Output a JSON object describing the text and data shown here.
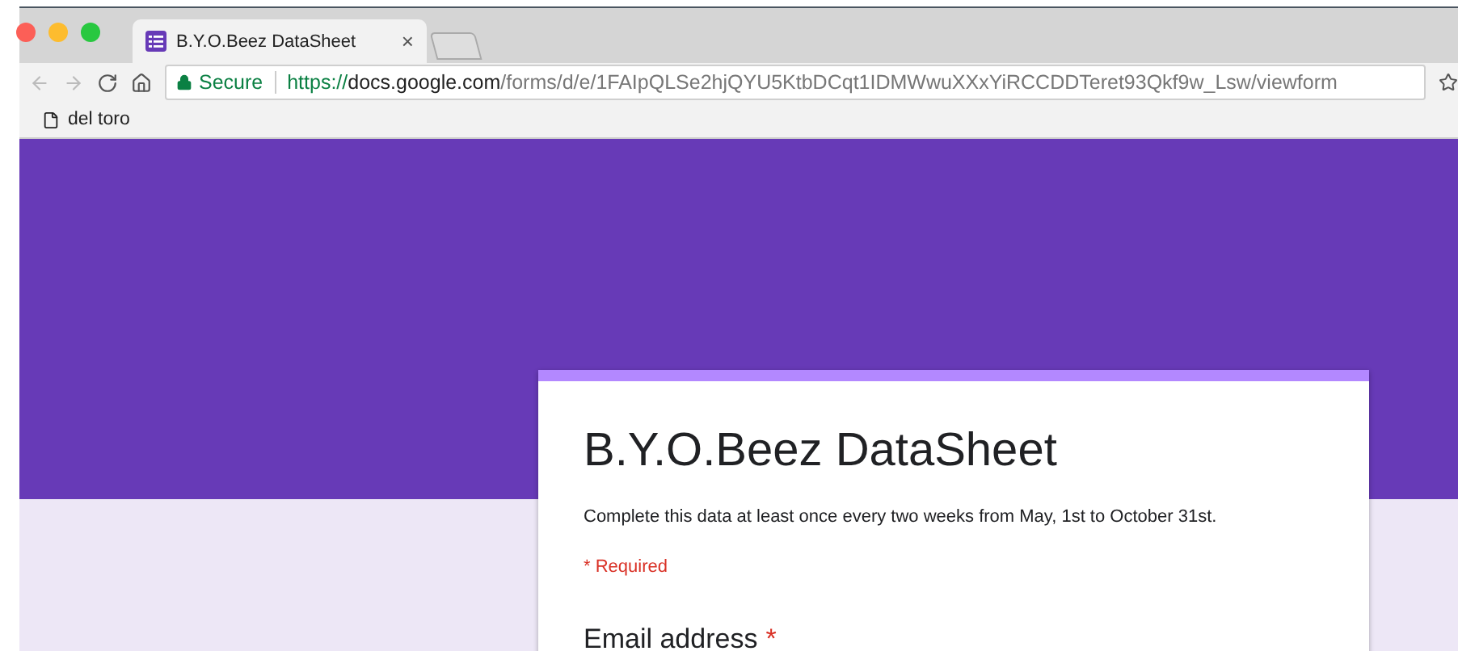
{
  "browser": {
    "tab": {
      "title": "B.Y.O.Beez DataSheet",
      "close": "×"
    },
    "address": {
      "secure_label": "Secure",
      "url_scheme": "https://",
      "url_host": "docs.google.com",
      "url_path": "/forms/d/e/1FAIpQLSe2hjQYU5KtbDCqt1IDMWwuXXxYiRCCDDTeret93Qkf9w_Lsw/viewform"
    },
    "bookmarks": [
      {
        "label": "del toro"
      }
    ]
  },
  "form": {
    "title": "B.Y.O.Beez DataSheet",
    "description": "Complete this data at least once every two weeks from May, 1st to October 31st.",
    "required_note": "* Required",
    "questions": [
      {
        "label": "Email address",
        "required": true,
        "required_mark": "*"
      }
    ]
  }
}
